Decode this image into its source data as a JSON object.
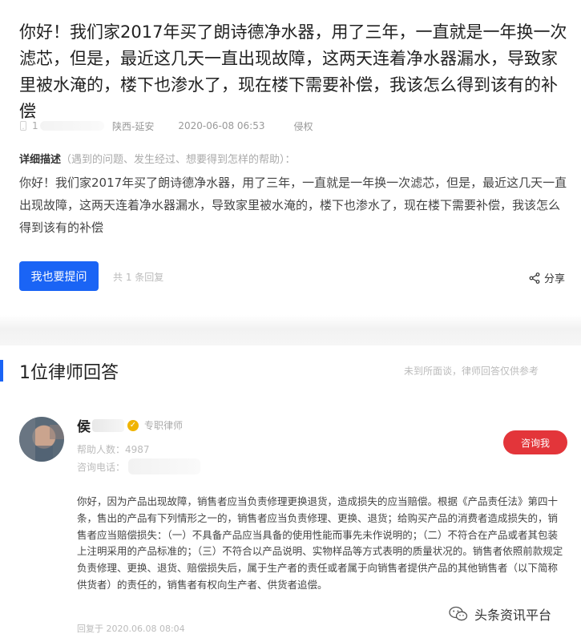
{
  "question": {
    "title": "你好！我们家2017年买了朗诗德净水器，用了三年，一直就是一年换一次滤芯，但是，最近这几天一直出现故障，这两天连着净水器漏水，导致家里被水淹的，楼下也渗水了，现在楼下需要补偿，我该怎么得到该有的补偿",
    "phone_prefix": "1",
    "location": "陕西-延安",
    "time": "2020-06-08 06:53",
    "category": "侵权",
    "detail_label": "详细描述",
    "detail_hint": "（遇到的问题、发生经过、想要得到怎样的帮助）：",
    "body": "你好！我们家2017年买了朗诗德净水器，用了三年，一直就是一年换一次滤芯，但是，最近这几天一直出现故障，这两天连着净水器漏水，导致家里被水淹的，楼下也渗水了，现在楼下需要补偿，我该怎么得到该有的补偿",
    "ask_button": "我也要提问",
    "reply_count": "共 1 条回复",
    "share_label": "分享"
  },
  "answers": {
    "heading": "1位律师回答",
    "disclaimer": "未到所面谈，律师回答仅供参考",
    "lawyer": {
      "name_visible": "侯",
      "name_end": "",
      "badge": "✓",
      "role": "专职律师",
      "helped_label": "帮助人数：",
      "helped_count": "4987",
      "phone_label": "咨询电话："
    },
    "consult_button": "咨询我",
    "answer_text": "你好，因为产品出现故障，销售者应当负责修理更换退货，造成损失的应当赔偿。根据《产品责任法》第四十条，售出的产品有下列情形之一的，销售者应当负责修理、更换、退货；给购买产品的消费者造成损失的，销售者应当赔偿损失：（一）不具备产品应当具备的使用性能而事先未作说明的；（二）不符合在产品或者其包装上注明采用的产品标准的；（三）不符合以产品说明、实物样品等方式表明的质量状况的。销售者依照前款规定负责修理、更换、退货、赔偿损失后，属于生产者的责任或者属于向销售者提供产品的其他销售者（以下简称供货者）的责任的，销售者有权向生产者、供货者追偿。",
    "reply_time": "回复于 2020.06.08 08:04"
  },
  "watermark": "头条资讯平台",
  "colors": {
    "accent": "#1a64f5",
    "consult": "#e3353a",
    "badge": "#f0b400"
  }
}
